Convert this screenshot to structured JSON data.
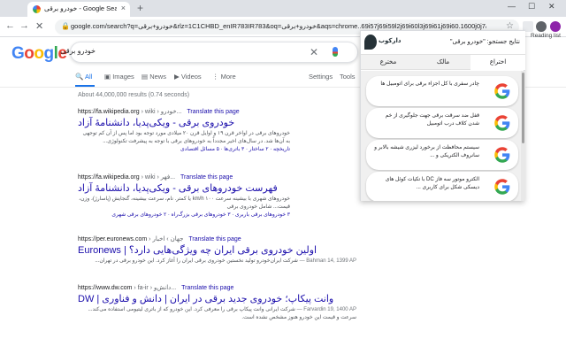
{
  "browser": {
    "tab_title": "خودرو برقی - Google Search",
    "tab_close": "×",
    "new_tab": "+",
    "url": "google.com/search?q=خودرو+برقی&rlz=1C1CHBD_enIR783IR783&oq=خودرو+برقی&aqs=chrome..69i57j69i59l2j69i60l3j69i61j69i60.1600j0j7&sourceid=...",
    "reading_list": "Reading list",
    "minimize": "—",
    "maximize": "☐",
    "close": "✕"
  },
  "search": {
    "query": "خودرو برقی",
    "tabs": [
      {
        "label": "All",
        "icon": "search-icon"
      },
      {
        "label": "Images",
        "icon": "image-icon"
      },
      {
        "label": "News",
        "icon": "news-icon"
      },
      {
        "label": "Videos",
        "icon": "video-icon"
      },
      {
        "label": "More",
        "icon": "more-icon"
      }
    ],
    "settings": "Settings",
    "tools": "Tools",
    "stats": "About 44,000,000 results (0.74 seconds)"
  },
  "results": [
    {
      "url": "https://fa.wikipedia.org",
      "crumb": "› wiki › خودرو...",
      "translate": "Translate this page",
      "title": "خودروی برقی - ویکی‌پدیا، دانشنامهٔ آزاد",
      "snippet": "خودروهای برقی در اواخر قرن ۱۹ و اوایل قرن ۲۰ میلادی مورد توجه بود اما پس از آن کم توجهی به آن‌ها شد. در سال‌های اخیر مجدداً به خودروهای برقی با توجه به پیشرفت تکنولوژی...",
      "links": "تاریخچه · ۲ ساختار · ۳ باتری‌ها · ۵ مسائل اقتصادی"
    },
    {
      "url": "https://fa.wikipedia.org",
      "crumb": "› wiki › فهر...",
      "translate": "Translate this page",
      "title": "فهرست خودروهای برقی - ویکی‌پدیا، دانشنامهٔ آزاد",
      "snippet": "خودروهای شهری با بیشینه سرعت ۱۰۰ km/h یا کمتر. نام، سرعت بیشینه، گنجایش (پاسارژ)، وزن، قیمت... شامل خودروی برقی",
      "links": "۳ خودروهای برقی باربری · ۳ خودروهای برقی بزرگ‌راه · ۲ خودروهای برقی شهری"
    },
    {
      "url": "https://per.euronews.com",
      "crumb": "› جهان › اخبار",
      "translate": "Translate this page",
      "title": "اولین خودروی برقی ایران چه ویژگی‌هایی دارد؟ | Euronews",
      "date": "Bahman 14, 1399 AP — ",
      "snippet": "شرکت ایران‌خودرو تولید نخستین خودروی برقی ایران را آغاز کرد. این خودرو برقی در تهران..."
    },
    {
      "url": "https://www.dw.com",
      "crumb": "› fa-ir › دانش‌و...",
      "translate": "Translate this page",
      "title": "وانت پیکاپ؛ خودروی جدید برقی در ایران | دانش و فناوری | DW",
      "date": "Farvardin 19, 1400 AP — ",
      "snippet": "شرکت ایرانی وانت پیکاپ برقی را معرفی کرد. این خودرو که از باتری لیتیومی استفاده می‌کند... سرعت و قیمت این خودرو هنوز مشخص نشده است."
    }
  ],
  "popup": {
    "brand": "دارکوب",
    "title": "نتایج جستجو: \"خودرو برقی\"",
    "tabs": [
      "اختراع",
      "مالک",
      "مخترع"
    ],
    "cards": [
      "چادر سفری با کل اجزاء برقی برای اتومبیل ها",
      "قفل ضد سرقت برقی جهت جلوگیری از خم شدن کلاف درب اتومبیل",
      "سیستم محافظت از برخورد لیزری شیشه بالابر و سانروف الکتریکی و ...",
      "الکترو موتور سه فاز DC با تکیات کوئل های دیسکی شکل برای کاربری ..."
    ]
  },
  "colors": {
    "link": "#1a0dab",
    "accent": "#1a73e8",
    "chrome": "#dee1e6"
  }
}
